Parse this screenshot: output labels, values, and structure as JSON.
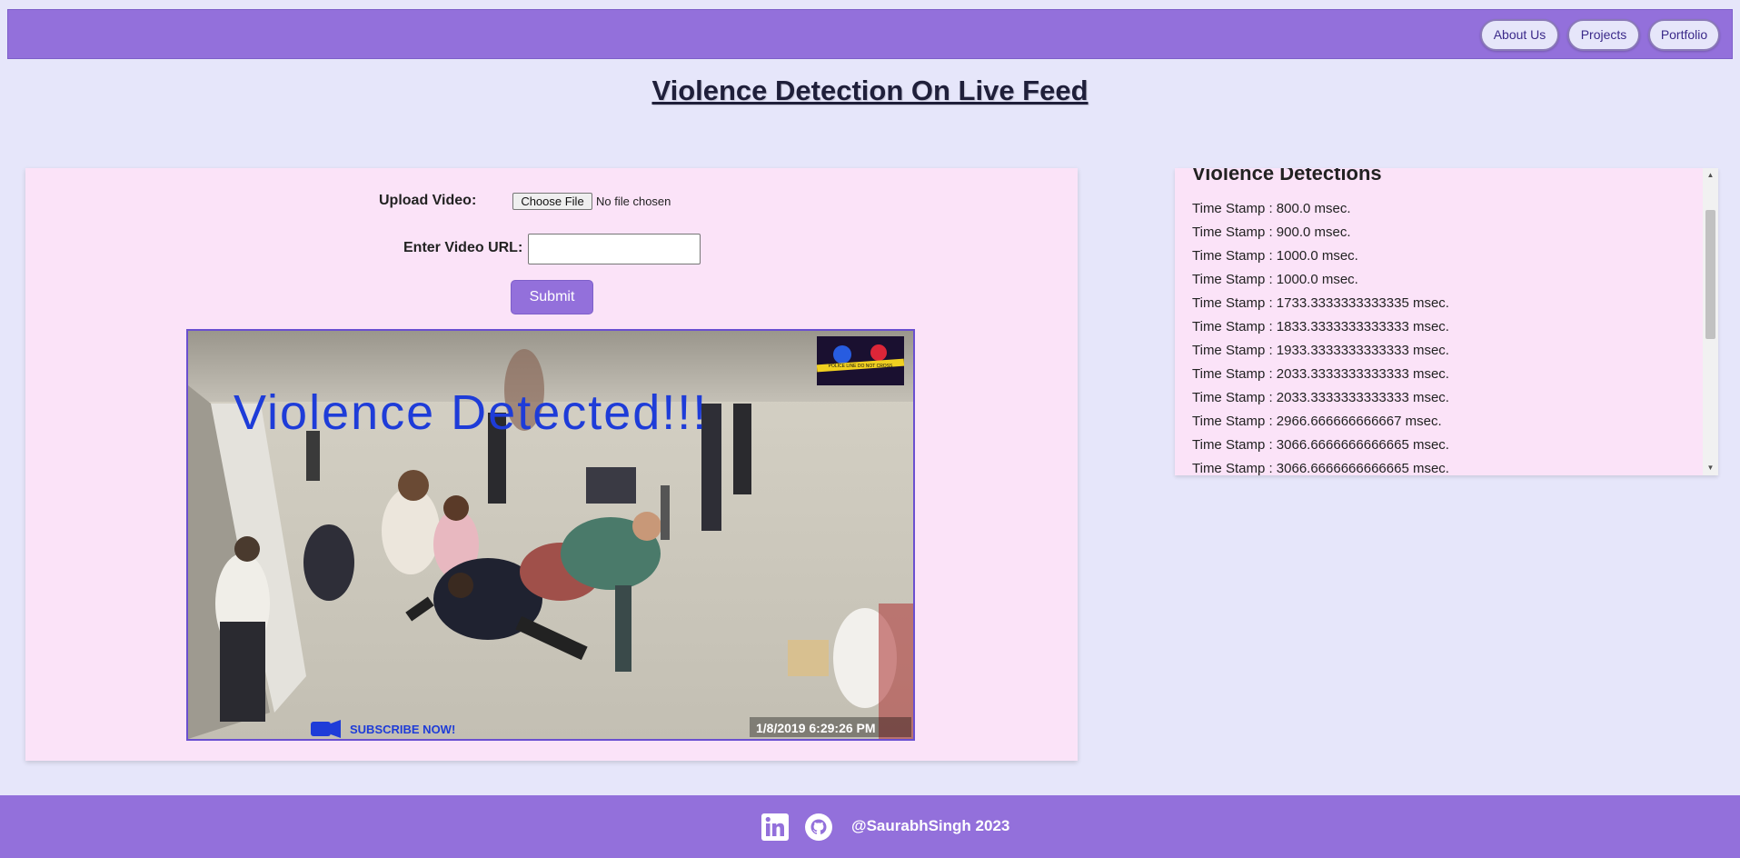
{
  "nav": {
    "items": [
      "About Us",
      "Projects",
      "Portfolio"
    ]
  },
  "page": {
    "title": "Violence Detection On Live Feed"
  },
  "upload": {
    "label": "Upload Video:",
    "file_button": "Choose File",
    "file_status": "No file chosen",
    "url_label": "Enter Video URL:",
    "url_value": "",
    "submit_label": "Submit"
  },
  "video": {
    "overlay_text": "Violence Detected!!!",
    "timestamp": "1/8/2019 6:29:26 PM",
    "subscribe_text": "SUBSCRIBE NOW!",
    "logo_text": "POLICE LINE DO NOT CROSS"
  },
  "detections": {
    "title": "Violence Detections",
    "items": [
      "Time Stamp : 800.0 msec.",
      "Time Stamp : 900.0 msec.",
      "Time Stamp : 1000.0 msec.",
      "Time Stamp : 1000.0 msec.",
      "Time Stamp : 1733.3333333333335 msec.",
      "Time Stamp : 1833.3333333333333 msec.",
      "Time Stamp : 1933.3333333333333 msec.",
      "Time Stamp : 2033.3333333333333 msec.",
      "Time Stamp : 2033.3333333333333 msec.",
      "Time Stamp : 2966.666666666667 msec.",
      "Time Stamp : 3066.6666666666665 msec.",
      "Time Stamp : 3066.6666666666665 msec."
    ]
  },
  "footer": {
    "text": "@SaurabhSingh 2023",
    "icons": [
      "linkedin-icon",
      "github-icon"
    ]
  },
  "colors": {
    "accent": "#9370db",
    "background": "#e6e6fa",
    "card": "#fbe3f8",
    "overlay_text": "#1e3cd8"
  }
}
